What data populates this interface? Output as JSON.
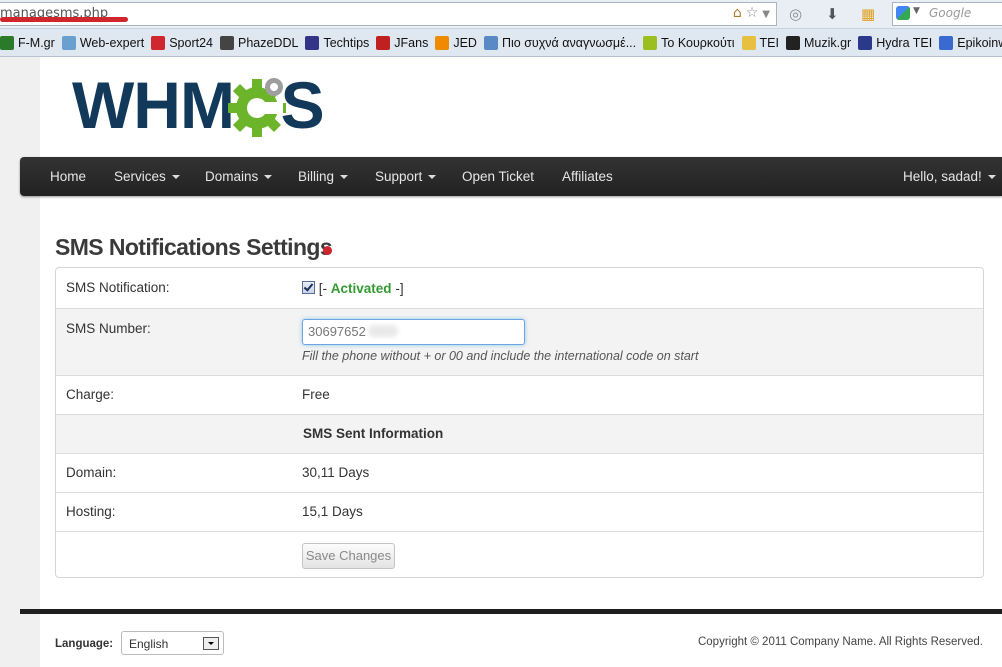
{
  "browser": {
    "url": "managesms.php",
    "search_placeholder": "Google",
    "bookmarks": [
      {
        "label": "F-M.gr",
        "color": "#2a7a2a"
      },
      {
        "label": "Web-expert",
        "color": "#6aa0d0"
      },
      {
        "label": "Sport24",
        "color": "#d0262e"
      },
      {
        "label": "PhazeDDL",
        "color": "#444444"
      },
      {
        "label": "Techtips",
        "color": "#333388"
      },
      {
        "label": "JFans",
        "color": "#c02020"
      },
      {
        "label": "JED",
        "color": "#f08a00"
      },
      {
        "label": "Πιο συχνά αναγνωσμέ...",
        "color": "#5a8ac6"
      },
      {
        "label": "Το Κουρκούτι",
        "color": "#9ac020"
      },
      {
        "label": "TEI",
        "color": "#e8c040"
      },
      {
        "label": "Muzik.gr",
        "color": "#222222"
      },
      {
        "label": "Hydra TEI",
        "color": "#2a3a8a"
      },
      {
        "label": "Epikoinwnia",
        "color": "#3a6ad0"
      }
    ]
  },
  "site": {
    "logo_text": "WHMCS",
    "logo_color": "#12385a",
    "gear_color": "#6cb42a"
  },
  "nav": {
    "home": "Home",
    "services": "Services",
    "domains": "Domains",
    "billing": "Billing",
    "support": "Support",
    "open_ticket": "Open Ticket",
    "affiliates": "Affiliates",
    "user": "Hello, sadad!"
  },
  "page": {
    "title": "SMS Notifications Settings"
  },
  "form": {
    "notification_label": "SMS Notification:",
    "activated_prefix": "[-",
    "activated_text": "Activated",
    "activated_suffix": "-]",
    "number_label": "SMS Number:",
    "number_value": "30697652",
    "number_hint": "Fill the phone without + or 00 and include the international code on start",
    "charge_label": "Charge:",
    "charge_value": "Free",
    "sent_info_header": "SMS Sent Information",
    "domain_label": "Domain:",
    "domain_value": "30,11 Days",
    "hosting_label": "Hosting:",
    "hosting_value": "15,1 Days",
    "save_button": "Save Changes"
  },
  "footer": {
    "language_label": "Language:",
    "language_value": "English",
    "copyright": "Copyright © 2011 Company Name. All Rights Reserved."
  }
}
